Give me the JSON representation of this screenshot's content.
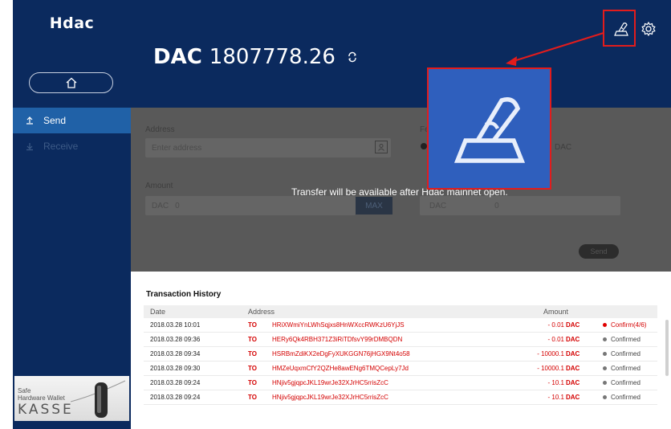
{
  "sidebar": {
    "brand": "Hdac",
    "items": [
      {
        "label": "Send"
      },
      {
        "label": "Receive"
      }
    ],
    "ad": {
      "line1": "Safe",
      "line2": "Hardware Wallet",
      "brand": "KASSE"
    }
  },
  "header": {
    "currency": "DAC",
    "balance": "1807778.26"
  },
  "form": {
    "address_label": "Address",
    "address_placeholder": "Enter address",
    "amount_label": "Amount",
    "amount_currency": "DAC",
    "amount_value": "0",
    "max_label": "MAX",
    "fee_label": "Fe",
    "fee_option": "DAC",
    "fee_currency": "DAC",
    "fee_value": "0",
    "send_label": "Send",
    "notice": "Transfer will be available after Hdac mainnet open."
  },
  "history": {
    "title": "Transaction History",
    "columns": {
      "date": "Date",
      "address": "Address",
      "amount": "Amount"
    },
    "rows": [
      {
        "date": "2018.03.28 10:01",
        "dir": "TO",
        "address": "HRiXWmiYnLWhSqjxs8HnWXccRWKzU6YjJS",
        "amount": "- 0.01",
        "currency": "DAC",
        "status": "Confirm(4/6)",
        "pending": true
      },
      {
        "date": "2018.03.28 09:36",
        "dir": "TO",
        "address": "HERy6Qk4RBH371Z3iRiTDfsvY99rDMBQDN",
        "amount": "- 0.01",
        "currency": "DAC",
        "status": "Confirmed",
        "pending": false
      },
      {
        "date": "2018.03.28 09:34",
        "dir": "TO",
        "address": "HSRBmZdiKX2eDgFyXUKGGN76jHGX9Nt4o58",
        "amount": "- 10000.1",
        "currency": "DAC",
        "status": "Confirmed",
        "pending": false
      },
      {
        "date": "2018.03.28 09:30",
        "dir": "TO",
        "address": "HMZeUqxmCfY2QZHe8awENg6TMQCepLy7Jd",
        "amount": "- 10000.1",
        "currency": "DAC",
        "status": "Confirmed",
        "pending": false
      },
      {
        "date": "2018.03.28 09:24",
        "dir": "TO",
        "address": "HNjiv5gjqpcJKL19wrJe32XJrHC5rrisZcC",
        "amount": "- 10.1",
        "currency": "DAC",
        "status": "Confirmed",
        "pending": false
      },
      {
        "date": "2018.03.28 09:24",
        "dir": "TO",
        "address": "HNjiv5gjqpcJKL19wrJe32XJrHC5rrisZcC",
        "amount": "- 10.1",
        "currency": "DAC",
        "status": "Confirmed",
        "pending": false
      }
    ]
  },
  "colors": {
    "navy": "#0b2a5e",
    "active": "#2061a7",
    "red": "#d40000",
    "highlight": "#e21c1c",
    "zoom_bg": "#2f5fbd"
  },
  "icons": [
    "home-icon",
    "send-icon",
    "receive-icon",
    "refresh-icon",
    "sign-icon",
    "gear-icon"
  ]
}
